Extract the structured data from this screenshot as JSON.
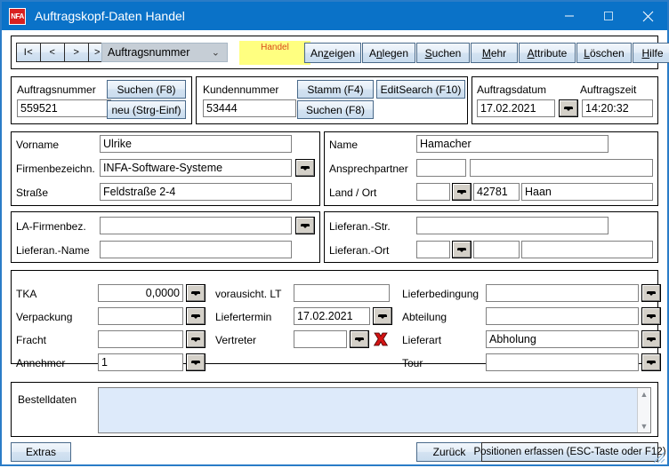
{
  "window": {
    "title": "Auftragskopf-Daten Handel",
    "icon_text": "NFA",
    "minimize": "minimize-icon",
    "maximize": "maximize-icon",
    "close": "close-icon"
  },
  "toolbar": {
    "nav": [
      "I<",
      "<",
      ">",
      "> I"
    ],
    "select_value": "Auftragsnummer",
    "badge": "Handel",
    "buttons": [
      {
        "pre": "An",
        "acc": "z",
        "post": "eigen"
      },
      {
        "pre": "A",
        "acc": "n",
        "post": "legen"
      },
      {
        "pre": "",
        "acc": "S",
        "post": "uchen"
      },
      {
        "pre": "",
        "acc": "M",
        "post": "ehr"
      },
      {
        "pre": "",
        "acc": "A",
        "post": "ttribute"
      },
      {
        "pre": "",
        "acc": "L",
        "post": "öschen"
      },
      {
        "pre": "",
        "acc": "H",
        "post": "ilfe"
      }
    ]
  },
  "order_group": {
    "label": "Auftragsnummer",
    "value": "559521",
    "btn_search": "Suchen (F8)",
    "btn_new": "neu (Strg-Einf)"
  },
  "customer_group": {
    "label": "Kundennummer",
    "value": "53444",
    "btn_stamm": "Stamm (F4)",
    "btn_editsearch": "EditSearch (F10)",
    "btn_search": "Suchen (F8)"
  },
  "datetime_group": {
    "date_label": "Auftragsdatum",
    "date_value": "17.02.2021",
    "time_label": "Auftragszeit",
    "time_value": "14:20:32"
  },
  "address_group": {
    "vorname_label": "Vorname",
    "vorname_value": "Ulrike",
    "firma_label": "Firmenbezeichn.",
    "firma_value": "INFA-Software-Systeme",
    "strasse_label": "Straße",
    "strasse_value": "Feldstraße 2-4",
    "name_label": "Name",
    "name_value": "Hamacher",
    "ansprech_label": "Ansprechpartner",
    "ansprech_value1": "",
    "ansprech_value2": "",
    "land_ort_label": "Land / Ort",
    "land_value": "",
    "plz_value": "42781",
    "ort_value": "Haan"
  },
  "supplier_group": {
    "la_firmenbez_label": "LA-Firmenbez.",
    "la_firmenbez_value": "",
    "lieferan_name_label": "Lieferan.-Name",
    "lieferan_name_value": "",
    "lieferan_str_label": "Lieferan.-Str.",
    "lieferan_str_value": "",
    "lieferan_ort_label": "Lieferan.-Ort",
    "lieferan_land_value": "",
    "lieferan_plz_value": "",
    "lieferan_ort_value": ""
  },
  "details_group": {
    "tka_label": "TKA",
    "tka_value": "0,0000",
    "verpackung_label": "Verpackung",
    "verpackung_value": "",
    "fracht_label": "Fracht",
    "fracht_value": "",
    "annehmer_label": "Annehmer",
    "annehmer_value": "1",
    "vorausicht_label": "vorausicht. LT",
    "vorausicht_value": "",
    "liefertermin_label": "Liefertermin",
    "liefertermin_value": "17.02.2021",
    "vertreter_label": "Vertreter",
    "vertreter_value": "",
    "vertreter_clear_icon": "red-x-icon",
    "lieferbedingung_label": "Lieferbedingung",
    "lieferbedingung_value": "",
    "abteilung_label": "Abteilung",
    "abteilung_value": "",
    "lieferart_label": "Lieferart",
    "lieferart_value": "Abholung",
    "tour_label": "Tour",
    "tour_value": ""
  },
  "bestelldaten": {
    "label": "Bestelldaten",
    "value": ""
  },
  "footer": {
    "extras": "Extras",
    "zurueck": "Zurück",
    "status": "Positionen erfassen (ESC-Taste oder F12)"
  },
  "colors": {
    "titlebar": "#0a72c8",
    "badge_bg": "#ffff80",
    "badge_fg": "#d84a1b",
    "textarea_bg": "#ddeafa",
    "window_border": "#2a7cc7"
  }
}
